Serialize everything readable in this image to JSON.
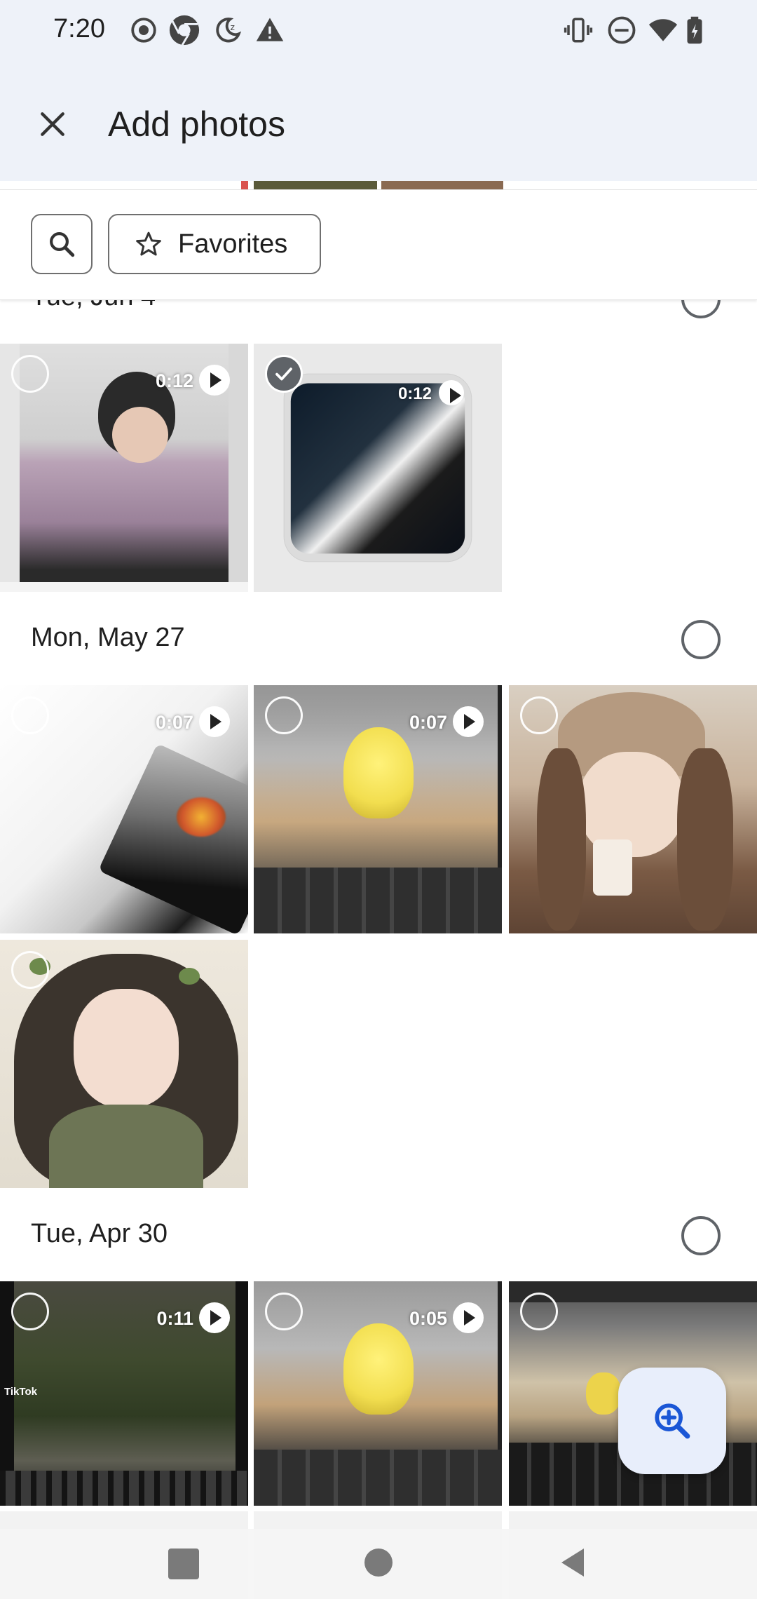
{
  "status_bar": {
    "time": "7:20",
    "icons_left": [
      "record-icon",
      "chrome-icon",
      "moon-icon",
      "alert-icon"
    ],
    "icons_right": [
      "vibrate-icon",
      "dnd-icon",
      "wifi-icon",
      "battery-icon"
    ]
  },
  "app_bar": {
    "title": "Add photos",
    "close_icon": "close-icon"
  },
  "filters": {
    "search_icon": "search-icon",
    "favorites_label": "Favorites"
  },
  "sections": [
    {
      "date": "Tue, Jun 4",
      "items": [
        {
          "type": "video",
          "duration": "0:12",
          "selected": false
        },
        {
          "type": "video",
          "duration": "0:12",
          "selected": true
        }
      ]
    },
    {
      "date": "Mon, May 27",
      "items": [
        {
          "type": "video",
          "duration": "0:07",
          "selected": false
        },
        {
          "type": "video",
          "duration": "0:07",
          "selected": false
        },
        {
          "type": "photo",
          "selected": false
        },
        {
          "type": "photo",
          "selected": false
        }
      ]
    },
    {
      "date": "Tue, Apr 30",
      "items": [
        {
          "type": "video",
          "duration": "0:11",
          "selected": false,
          "watermark": "TikTok"
        },
        {
          "type": "video",
          "duration": "0:05",
          "selected": false
        },
        {
          "type": "photo",
          "selected": false
        }
      ]
    }
  ],
  "fab": {
    "icon": "zoom-in-icon"
  },
  "nav": [
    "recents-button",
    "home-button",
    "back-button"
  ]
}
